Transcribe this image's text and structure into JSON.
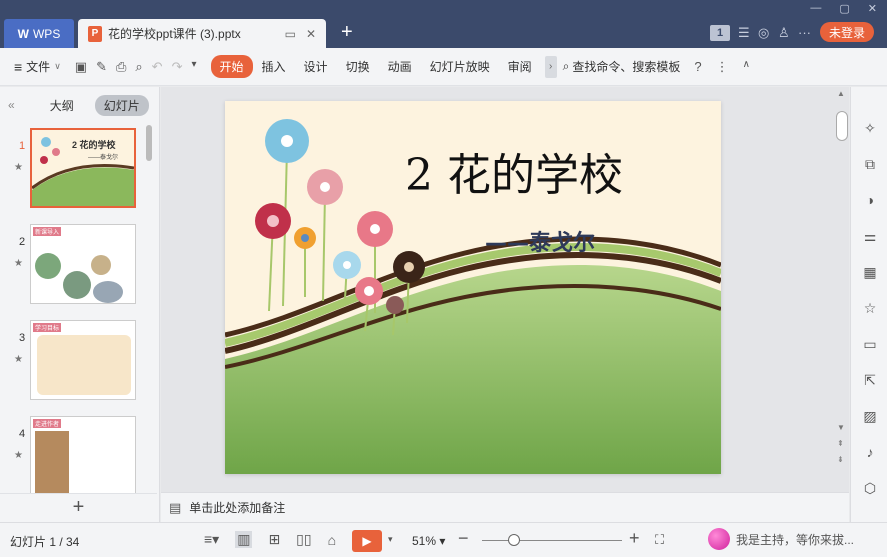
{
  "titlebar": {
    "wps_tab": "WPS",
    "file_tab": "花的学校ppt课件 (3).pptx",
    "page_badge": "1",
    "login": "未登录"
  },
  "ribbon": {
    "file_menu": "文件",
    "tabs": [
      "开始",
      "插入",
      "设计",
      "切换",
      "动画",
      "幻灯片放映",
      "审阅"
    ],
    "active_tab": "开始",
    "search": "查找命令、搜索模板"
  },
  "left_panel": {
    "tab_outline": "大纲",
    "tab_slides": "幻灯片",
    "slides": [
      {
        "num": "1",
        "title": "2 花的学校",
        "sub": "——泰戈尔"
      },
      {
        "num": "2",
        "label": "新课导入"
      },
      {
        "num": "3",
        "label": "学习目标"
      },
      {
        "num": "4",
        "label": "走进作者"
      }
    ]
  },
  "slide": {
    "title": "2 花的学校",
    "subtitle": "——泰戈尔"
  },
  "notes": {
    "placeholder": "单击此处添加备注"
  },
  "status": {
    "slide_count": "幻灯片 1 / 34",
    "zoom": "51%",
    "watermark_text": "我是主持，等你来拔..."
  },
  "colors": {
    "accent": "#e8623b",
    "titlebar": "#3b4a6b",
    "wps_tab": "#4a6dc4"
  }
}
